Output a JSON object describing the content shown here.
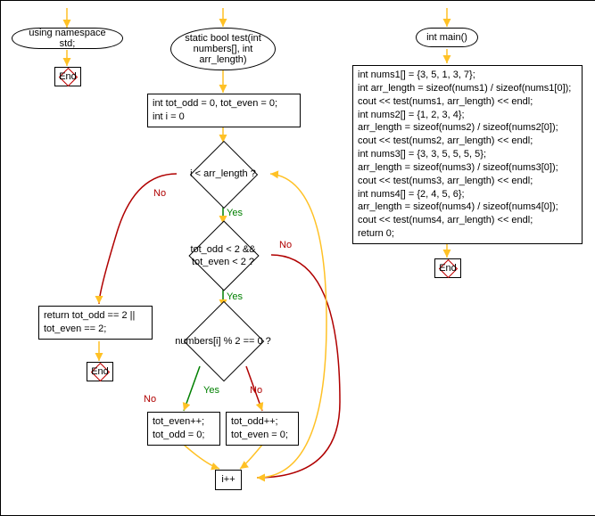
{
  "namespace_entry": "using namespace std;",
  "namespace_end": "End",
  "func_sig": "static bool test(int numbers[], int arr_length)",
  "init_block": "int tot_odd = 0, tot_even = 0;\nint i = 0",
  "cond_loop": "i < arr_length ?",
  "cond_totals": "tot_odd < 2 && tot_even < 2 ?",
  "cond_mod": "numbers[i] % 2 == 0 ?",
  "even_block": "tot_even++; tot_odd = 0;",
  "odd_block": "tot_odd++; tot_even = 0;",
  "inc_block": "i++",
  "return_block": "return tot_odd == 2 || tot_even == 2;",
  "func_end": "End",
  "main_sig": "int main()",
  "main_body": "int nums1[] = {3, 5, 1, 3, 7};\nint arr_length = sizeof(nums1) / sizeof(nums1[0]);\ncout << test(nums1, arr_length) << endl;\nint nums2[] = {1, 2, 3, 4};\narr_length = sizeof(nums2) / sizeof(nums2[0]);\ncout << test(nums2, arr_length) << endl;\nint nums3[] = {3, 3, 5, 5, 5, 5};\narr_length = sizeof(nums3) / sizeof(nums3[0]);\ncout << test(nums3, arr_length) << endl;\nint nums4[] = {2, 4, 5, 6};\narr_length = sizeof(nums4) / sizeof(nums4[0]);\ncout << test(nums4, arr_length) << endl;\nreturn 0;",
  "main_end": "End",
  "yes": "Yes",
  "no": "No",
  "arrow_color": "#FFC125",
  "yes_color": "#008000",
  "no_color": "#B00000"
}
